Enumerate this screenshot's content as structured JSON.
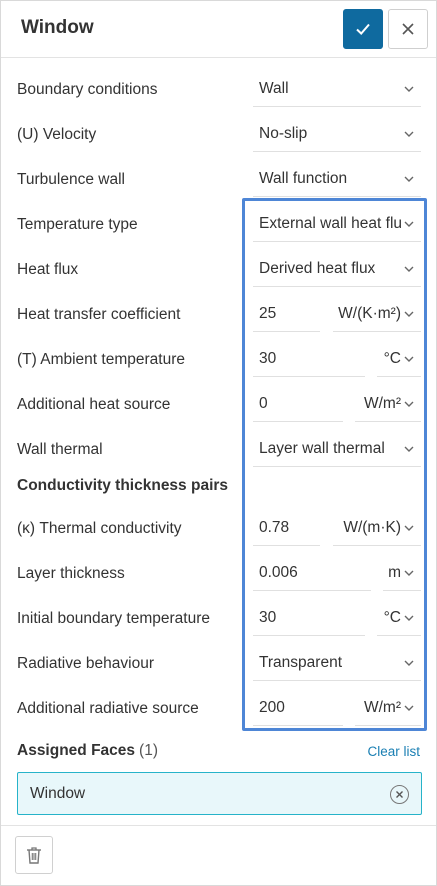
{
  "header": {
    "title": "Window"
  },
  "rows": [
    {
      "label": "Boundary conditions",
      "value": "Wall"
    },
    {
      "label": "(U) Velocity",
      "value": "No-slip"
    },
    {
      "label": "Turbulence wall",
      "value": "Wall function"
    },
    {
      "label": "Temperature type",
      "value": "External wall heat flu"
    },
    {
      "label": "Heat flux",
      "value": "Derived heat flux"
    },
    {
      "label": "Heat transfer coefficient",
      "value": "25",
      "unit": "W/(K·m²)"
    },
    {
      "label": "(T) Ambient temperature",
      "value": "30",
      "unit": "°C"
    },
    {
      "label": "Additional heat source",
      "value": "0",
      "unit": "W/m²"
    },
    {
      "label": "Wall thermal",
      "value": "Layer wall thermal"
    },
    {
      "label": "Conductivity thickness pairs"
    },
    {
      "label": "(κ) Thermal conductivity",
      "value": "0.78",
      "unit": "W/(m·K)"
    },
    {
      "label": "Layer thickness",
      "value": "0.006",
      "unit": "m"
    },
    {
      "label": "Initial boundary temperature",
      "value": "30",
      "unit": "°C"
    },
    {
      "label": "Radiative behaviour",
      "value": "Transparent"
    },
    {
      "label": "Additional radiative source",
      "value": "200",
      "unit": "W/m²"
    }
  ],
  "assigned_faces": {
    "label": "Assigned Faces",
    "count": "(1)",
    "clear_label": "Clear list",
    "items": [
      "Window"
    ]
  },
  "colors": {
    "primary": "#0f6a9f",
    "highlight": "#4e86d6",
    "accent": "#26b3c9",
    "link": "#1a7fb3"
  }
}
